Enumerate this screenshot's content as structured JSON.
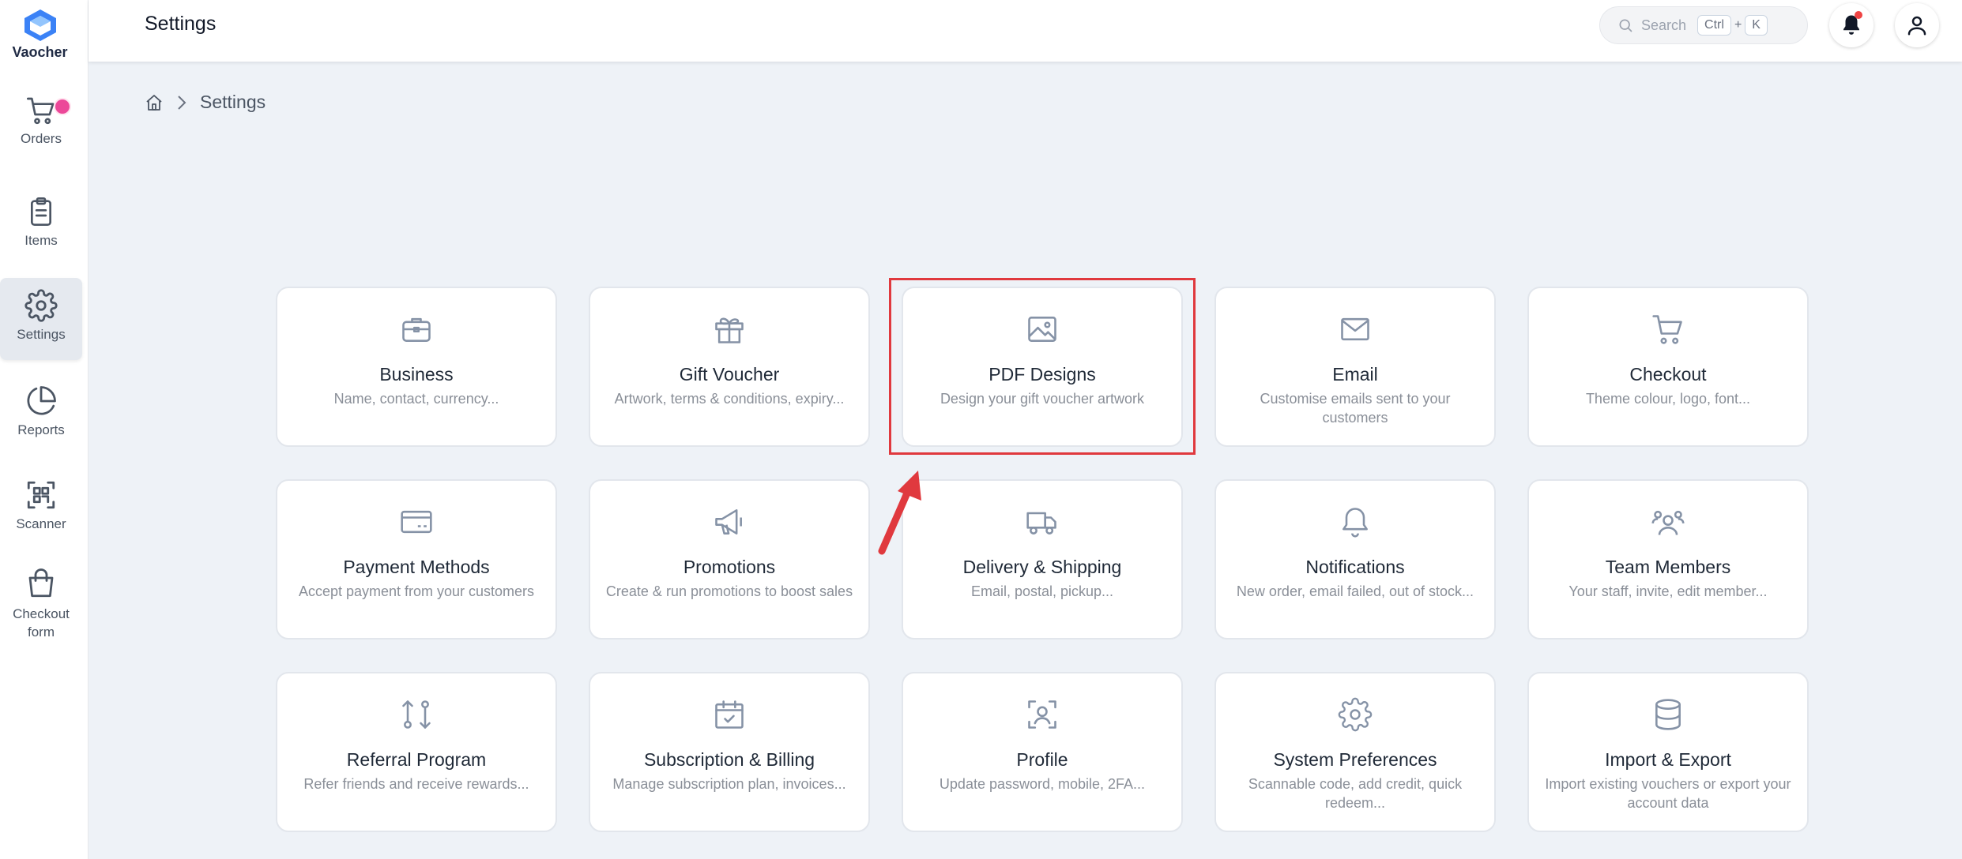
{
  "app": {
    "name": "Vaocher"
  },
  "sidebar": {
    "items": [
      {
        "label": "Orders",
        "icon": "cart-icon",
        "badge": true
      },
      {
        "label": "Items",
        "icon": "clipboard-icon"
      },
      {
        "label": "Settings",
        "icon": "gear-icon",
        "active": true
      },
      {
        "label": "Reports",
        "icon": "pie-chart-icon"
      },
      {
        "label": "Scanner",
        "icon": "qr-scan-icon"
      },
      {
        "label": "Checkout form",
        "icon": "shopping-bag-icon"
      }
    ]
  },
  "header": {
    "title": "Settings",
    "search": {
      "placeholder": "Search",
      "shortcut_key1": "Ctrl",
      "shortcut_plus": "+",
      "shortcut_key2": "K"
    }
  },
  "breadcrumb": {
    "current": "Settings"
  },
  "cards": [
    {
      "title": "Business",
      "desc": "Name, contact, currency...",
      "icon": "briefcase-icon"
    },
    {
      "title": "Gift Voucher",
      "desc": "Artwork, terms & conditions, expiry...",
      "icon": "gift-icon"
    },
    {
      "title": "PDF Designs",
      "desc": "Design your gift voucher artwork",
      "icon": "image-icon",
      "highlighted": true
    },
    {
      "title": "Email",
      "desc": "Customise emails sent to your customers",
      "icon": "mail-icon"
    },
    {
      "title": "Checkout",
      "desc": "Theme colour, logo, font...",
      "icon": "cart-icon"
    },
    {
      "title": "Payment Methods",
      "desc": "Accept payment from your customers",
      "icon": "credit-card-icon"
    },
    {
      "title": "Promotions",
      "desc": "Create & run promotions to boost sales",
      "icon": "megaphone-icon"
    },
    {
      "title": "Delivery & Shipping",
      "desc": "Email, postal, pickup...",
      "icon": "truck-icon"
    },
    {
      "title": "Notifications",
      "desc": "New order, email failed, out of stock...",
      "icon": "bell-icon"
    },
    {
      "title": "Team Members",
      "desc": "Your staff, invite, edit member...",
      "icon": "users-icon"
    },
    {
      "title": "Referral Program",
      "desc": "Refer friends and receive rewards...",
      "icon": "git-compare-icon"
    },
    {
      "title": "Subscription & Billing",
      "desc": "Manage subscription plan, invoices...",
      "icon": "calendar-check-icon"
    },
    {
      "title": "Profile",
      "desc": "Update password, mobile, 2FA...",
      "icon": "user-scan-icon"
    },
    {
      "title": "System Preferences",
      "desc": "Scannable code, add credit, quick redeem...",
      "icon": "gear-icon"
    },
    {
      "title": "Import & Export",
      "desc": "Import existing vouchers or export your account data",
      "icon": "database-icon"
    }
  ],
  "colors": {
    "accent": "#e0393e",
    "badge": "#ec4899",
    "icon": "#8592a6"
  }
}
